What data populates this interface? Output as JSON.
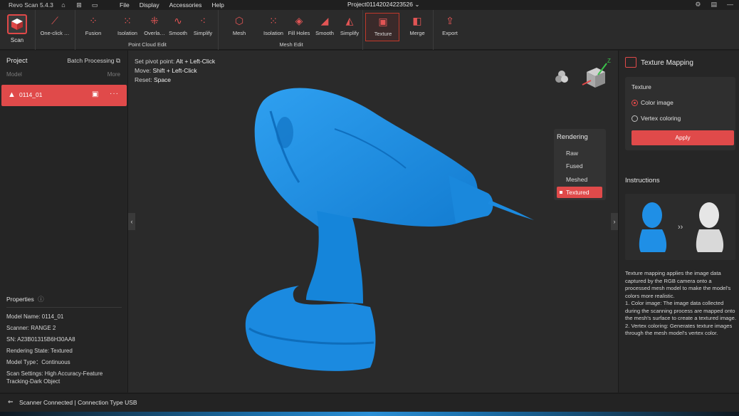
{
  "titlebar": {
    "app_name": "Revo Scan 5.4.3",
    "menu": [
      "File",
      "Display",
      "Accessories",
      "Help"
    ],
    "project_title": "Project01142024223526 ⌄"
  },
  "toolbar": {
    "scan_label": "Scan",
    "one_click_label": "One-click …",
    "point_cloud_tools": [
      "Fusion",
      "Isolation",
      "Overla…",
      "Smooth",
      "Simplify"
    ],
    "point_cloud_group": "Point Cloud Edit",
    "mesh_tools": [
      "Mesh",
      "Isolation",
      "Fill Holes",
      "Smooth",
      "Simplify"
    ],
    "mesh_group": "Mesh Edit",
    "texture_label": "Texture",
    "merge_label": "Merge",
    "export_label": "Export"
  },
  "left_panel": {
    "title": "Project",
    "batch": "Batch Processing",
    "col_model": "Model",
    "col_more": "More",
    "model_name": "0114_01",
    "properties_title": "Properties",
    "properties": [
      "Model Name:  0114_01",
      "Scanner:  RANGE 2",
      "SN:  A23B01315B6H30AA8",
      "Rendering State:  Textured",
      "Model Type：Continuous",
      "Scan Settings:  High Accuracy-Feature Tracking-Dark Object"
    ]
  },
  "viewport": {
    "hints": [
      {
        "label": "Set pivot point: ",
        "value": "Alt + Left-Click"
      },
      {
        "label": "Move: ",
        "value": "Shift + Left-Click"
      },
      {
        "label": "Reset: ",
        "value": "Space"
      }
    ],
    "axis_label": "Z",
    "rendering": {
      "title": "Rendering",
      "options": [
        "Raw",
        "Fused",
        "Meshed",
        "Textured"
      ],
      "active": "Textured"
    },
    "model_color": "#1f8fe6"
  },
  "right_panel": {
    "title": "Texture Mapping",
    "texture_label": "Texture",
    "option_color": "Color image",
    "option_vertex": "Vertex coloring",
    "apply": "Apply",
    "instructions_title": "Instructions",
    "instructions_text": "Texture mapping applies the image data captured by the RGB camera onto a processed mesh model to make the model's colors more realistic.\n1. Color image: The image data collected during the scanning process are mapped onto the mesh's surface to create a textured image.\n2. Vertex coloring: Generates texture images through the mesh model's vertex color."
  },
  "statusbar": {
    "text": "Scanner Connected | Connection Type USB"
  },
  "colors": {
    "accent": "#e04a4a",
    "background": "#2a2a2a"
  }
}
